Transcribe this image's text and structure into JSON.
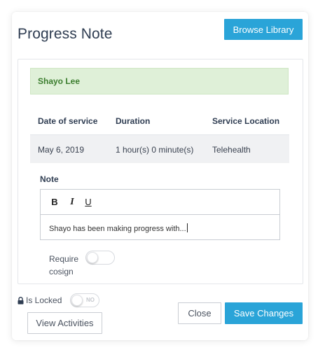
{
  "dialog": {
    "title": "Progress Note",
    "browse_library_label": "Browse Library"
  },
  "client": {
    "name": "Shayo Lee"
  },
  "service_table": {
    "headers": [
      "Date of service",
      "Duration",
      "Service Location"
    ],
    "row": [
      "May 6, 2019",
      "1 hour(s) 0 minute(s)",
      "Telehealth"
    ]
  },
  "note": {
    "label": "Note",
    "toolbar": {
      "bold": "B",
      "italic": "I",
      "underline": "U"
    },
    "text": "Shayo has been making progress with..."
  },
  "require_cosign": {
    "label_line1": "Require",
    "label_line2": "cosign",
    "enabled": false
  },
  "lock": {
    "label": "Is Locked",
    "toggle_text": "NO",
    "enabled": false
  },
  "buttons": {
    "view_activities": "View Activities",
    "close": "Close",
    "save_changes": "Save Changes"
  },
  "colors": {
    "accent": "#2aa4d8",
    "client_bar_bg": "#dff0d8",
    "client_name": "#3b7d2e",
    "title": "#2f3d52"
  },
  "icons": {
    "lock": "lock-icon"
  }
}
